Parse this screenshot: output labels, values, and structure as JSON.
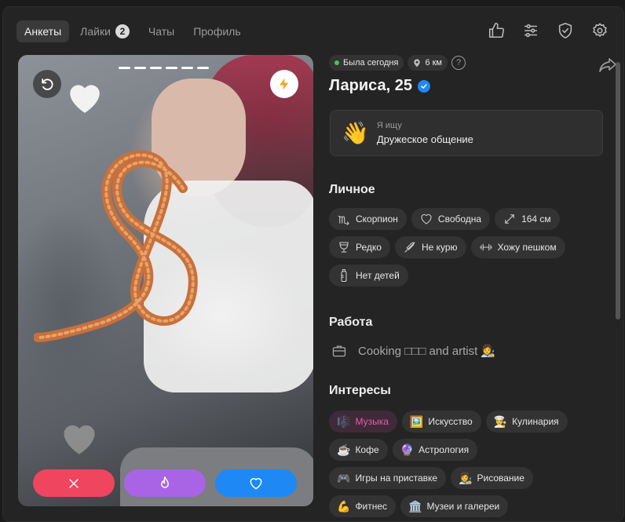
{
  "tabs": [
    {
      "label": "Анкеты",
      "active": true
    },
    {
      "label": "Лайки",
      "badge": "2"
    },
    {
      "label": "Чаты"
    },
    {
      "label": "Профиль"
    }
  ],
  "top_icons": [
    "thumbs-up-icon",
    "filters-icon",
    "shield-check-icon",
    "gear-icon"
  ],
  "photo": {
    "photo_count": 6,
    "current_photo": 1
  },
  "actions": {
    "dislike": "close-icon",
    "superlike": "fire-icon",
    "like": "heart-icon"
  },
  "profile": {
    "status": "Была сегодня",
    "distance": "6 км",
    "help": "?",
    "name": "Лариса, 25",
    "seek_label": "Я ищу",
    "seek_value": "Дружеское общение",
    "seek_emoji": "👋"
  },
  "sections": {
    "personal": "Личное",
    "work": "Работа",
    "interests": "Интересы"
  },
  "personal_chips": [
    {
      "label": "Скорпион",
      "icon": "scorpio-icon"
    },
    {
      "label": "Свободна",
      "icon": "heart-outline-icon"
    },
    {
      "label": "164 см",
      "icon": "height-arrows-icon"
    },
    {
      "label": "Редко",
      "icon": "glass-icon"
    },
    {
      "label": "Не курю",
      "icon": "no-smoking-icon"
    },
    {
      "label": "Хожу пешком",
      "icon": "dumbbell-icon"
    },
    {
      "label": "Нет детей",
      "icon": "baby-bottle-icon"
    }
  ],
  "work_text": "Cooking □□□ and artist 👩‍🎨",
  "interests": [
    {
      "label": "Музыка",
      "emoji": "🎼",
      "highlighted": true
    },
    {
      "label": "Искусство",
      "emoji": "🖼️"
    },
    {
      "label": "Кулинария",
      "emoji": "👩‍🍳"
    },
    {
      "label": "Кофе",
      "emoji": "☕"
    },
    {
      "label": "Астрология",
      "emoji": "🔮"
    },
    {
      "label": "Игры на приставке",
      "emoji": "🎮"
    },
    {
      "label": "Рисование",
      "emoji": "👩‍🎨"
    },
    {
      "label": "Фитнес",
      "emoji": "💪"
    },
    {
      "label": "Музеи и галереи",
      "emoji": "🏛️"
    }
  ],
  "colors": {
    "dislike": "#f0455f",
    "superlike": "#a964e6",
    "like": "#1e88f5",
    "online": "#3ec95a"
  }
}
